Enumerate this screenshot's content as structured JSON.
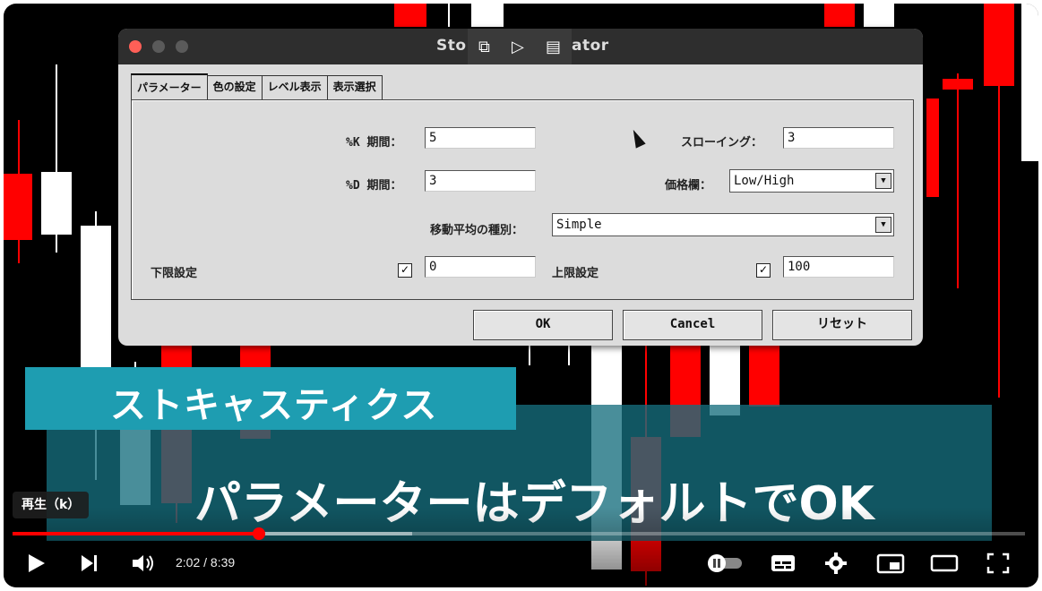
{
  "dialog": {
    "title_left": "Sto",
    "title_right": "ator",
    "tabs": [
      "パラメーター",
      "色の設定",
      "レベル表示",
      "表示選択"
    ],
    "k_period_label": "%K 期間：",
    "k_period_value": "5",
    "d_period_label": "%D 期間：",
    "d_period_value": "3",
    "slowing_label": "スローイング：",
    "slowing_value": "3",
    "price_field_label": "価格欄：",
    "price_field_value": "Low/High",
    "ma_method_label": "移動平均の種別：",
    "ma_method_value": "Simple",
    "lower_label": "下限設定",
    "lower_checked": true,
    "lower_value": "0",
    "upper_label": "上限設定",
    "upper_checked": true,
    "upper_value": "100",
    "buttons": {
      "ok": "OK",
      "cancel": "Cancel",
      "reset": "リセット"
    }
  },
  "captions": {
    "top": "ストキャスティクス",
    "bottom": "パラメーターはデフォルトでOK"
  },
  "player": {
    "tooltip": "再生（k）",
    "time_display": "2:02 / 8:39",
    "progress_fraction": 0.243,
    "icons": [
      "play-icon",
      "next-icon",
      "volume-icon",
      "autoplay-toggle-icon",
      "subtitles-icon",
      "settings-icon",
      "miniplayer-icon",
      "theater-icon",
      "fullscreen-icon"
    ]
  },
  "colors": {
    "bull": "#ffffff",
    "bear": "#ff1a1a",
    "progress": "#ff0000",
    "caption_top": "#1e9db1"
  }
}
